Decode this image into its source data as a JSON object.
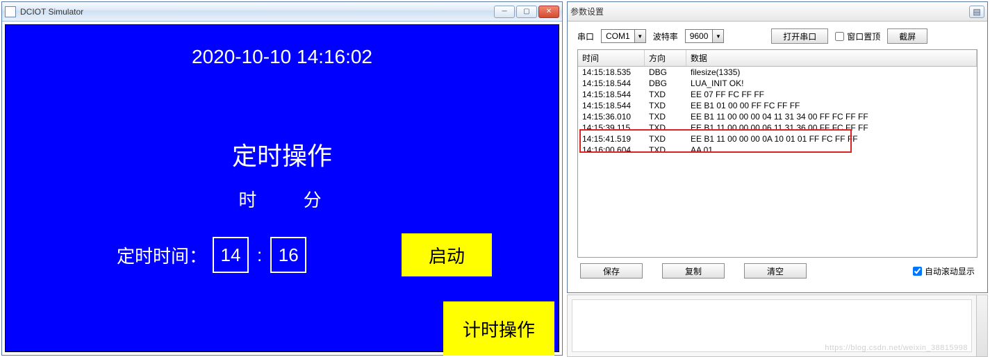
{
  "left": {
    "title": "DCIOT Simulator",
    "datetime": "2020-10-10 14:16:02",
    "heading": "定时操作",
    "hour_label": "时",
    "minute_label": "分",
    "schedule_label": "定时时间：",
    "hour_value": "14",
    "minute_value": "16",
    "colon": ":",
    "start_label": "启动",
    "timer_op_label": "计时操作"
  },
  "right": {
    "title": "参数设置",
    "serial_label": "串口",
    "serial_value": "COM1",
    "baud_label": "波特率",
    "baud_value": "9600",
    "open_btn": "打开串口",
    "pin_label": "窗口置顶",
    "pin_checked": false,
    "screenshot_btn": "截屏",
    "columns": {
      "time": "时间",
      "dir": "方向",
      "data": "数据"
    },
    "rows": [
      {
        "time": "14:15:18.535",
        "dir": "DBG",
        "data": "filesize(1335)"
      },
      {
        "time": "14:15:18.544",
        "dir": "DBG",
        "data": "LUA_INIT OK!"
      },
      {
        "time": "14:15:18.544",
        "dir": "TXD",
        "data": "EE 07 FF FC FF FF"
      },
      {
        "time": "14:15:18.544",
        "dir": "TXD",
        "data": "EE B1 01 00 00 FF FC FF FF"
      },
      {
        "time": "14:15:36.010",
        "dir": "TXD",
        "data": "EE B1 11 00 00 00 04 11 31 34 00 FF FC FF FF"
      },
      {
        "time": "14:15:39.115",
        "dir": "TXD",
        "data": "EE B1 11 00 00 00 06 11 31 36 00 FF FC FF FF"
      },
      {
        "time": "14:15:41.519",
        "dir": "TXD",
        "data": "EE B1 11 00 00 00 0A 10 01 01 FF FC FF FF"
      },
      {
        "time": "14:16:00.604",
        "dir": "TXD",
        "data": "AA 01"
      }
    ],
    "highlight_row_index": 7,
    "save_btn": "保存",
    "copy_btn": "复制",
    "clear_btn": "清空",
    "autoscroll_label": "自动滚动显示",
    "autoscroll_checked": true
  }
}
